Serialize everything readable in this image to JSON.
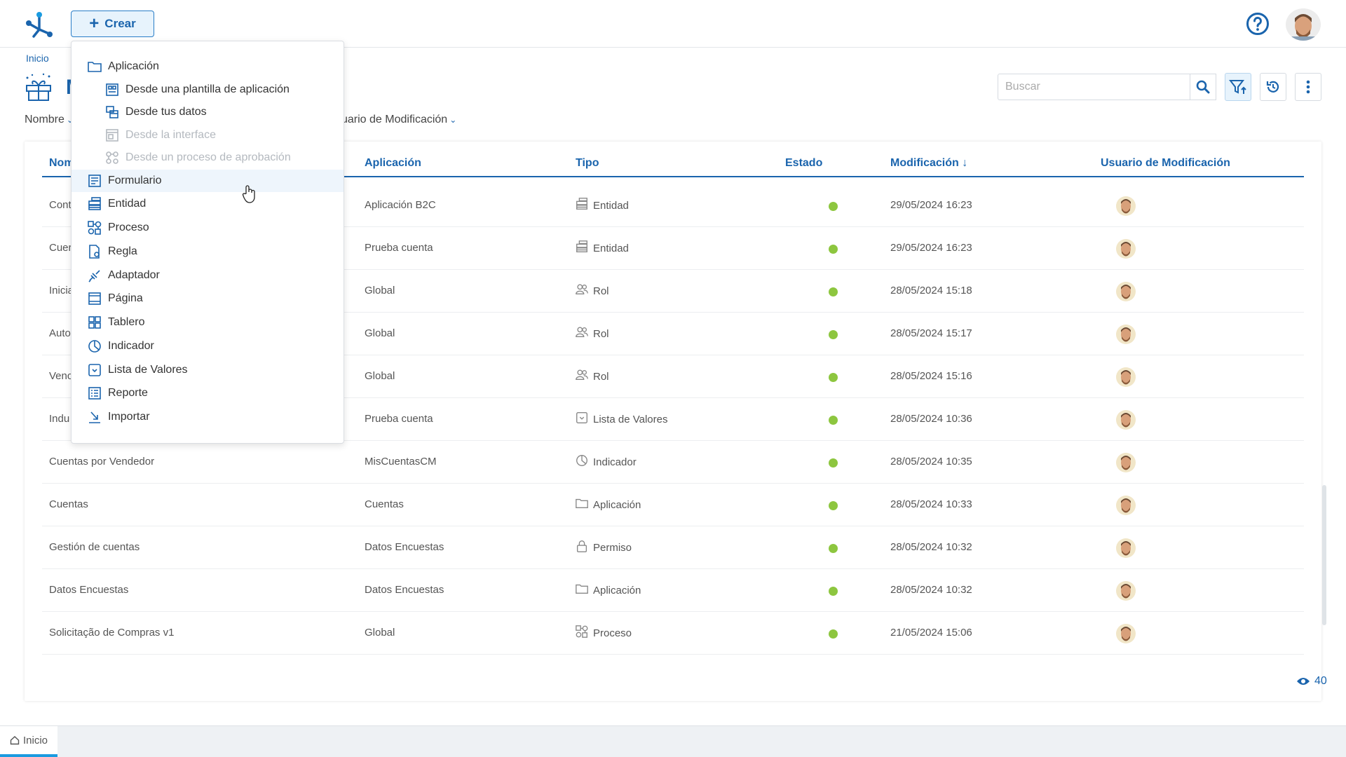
{
  "header": {
    "create_label": "Crear"
  },
  "breadcrumb": "Inicio",
  "page": {
    "title_partial": "M"
  },
  "search": {
    "placeholder": "Buscar"
  },
  "sort": {
    "nombre": "Nombre",
    "usuario": "uario de Modificación"
  },
  "table": {
    "columns": {
      "nombre": "Nom",
      "aplicacion": "Aplicación",
      "tipo": "Tipo",
      "estado": "Estado",
      "modificacion": "Modificación",
      "usuario": "Usuario de Modificación"
    },
    "rows": [
      {
        "name": "Cont",
        "app": "Aplicación B2C",
        "type": "Entidad",
        "icon": "entity-icon",
        "date": "29/05/2024 16:23"
      },
      {
        "name": "Cuer",
        "app": "Prueba cuenta",
        "type": "Entidad",
        "icon": "entity-icon",
        "date": "29/05/2024 16:23"
      },
      {
        "name": "Inicia",
        "app": "Global",
        "type": "Rol",
        "icon": "role-icon",
        "date": "28/05/2024 15:18"
      },
      {
        "name": "Auto",
        "app": "Global",
        "type": "Rol",
        "icon": "role-icon",
        "date": "28/05/2024 15:17"
      },
      {
        "name": "Venc",
        "app": "Global",
        "type": "Rol",
        "icon": "role-icon",
        "date": "28/05/2024 15:16"
      },
      {
        "name": "Indu",
        "app": "Prueba cuenta",
        "type": "Lista de Valores",
        "icon": "value-list-icon",
        "date": "28/05/2024 10:36"
      },
      {
        "name": "Cuentas por Vendedor",
        "app": "MisCuentasCM",
        "type": "Indicador",
        "icon": "indicator-icon",
        "date": "28/05/2024 10:35"
      },
      {
        "name": "Cuentas",
        "app": "Cuentas",
        "type": "Aplicación",
        "icon": "folder-icon",
        "date": "28/05/2024 10:33"
      },
      {
        "name": "Gestión de cuentas",
        "app": "Datos Encuestas",
        "type": "Permiso",
        "icon": "lock-icon",
        "date": "28/05/2024 10:32"
      },
      {
        "name": "Datos Encuestas",
        "app": "Datos Encuestas",
        "type": "Aplicación",
        "icon": "folder-icon",
        "date": "28/05/2024 10:32"
      },
      {
        "name": "Solicitação de Compras v1",
        "app": "Global",
        "type": "Proceso",
        "icon": "process-icon",
        "date": "21/05/2024 15:06"
      }
    ]
  },
  "count": "40",
  "menu": {
    "items": [
      {
        "label": "Aplicación",
        "level": 1,
        "icon": "folder-icon",
        "state": "enabled"
      },
      {
        "label": "Desde una plantilla de aplicación",
        "level": 2,
        "icon": "template-icon",
        "state": "enabled"
      },
      {
        "label": "Desde tus datos",
        "level": 2,
        "icon": "data-icon",
        "state": "enabled"
      },
      {
        "label": "Desde la interface",
        "level": 2,
        "icon": "interface-icon",
        "state": "disabled"
      },
      {
        "label": "Desde un proceso de aprobación",
        "level": 2,
        "icon": "approval-icon",
        "state": "disabled"
      },
      {
        "label": "Formulario",
        "level": 1,
        "icon": "form-icon",
        "state": "hover"
      },
      {
        "label": "Entidad",
        "level": 1,
        "icon": "entity-icon",
        "state": "enabled"
      },
      {
        "label": "Proceso",
        "level": 1,
        "icon": "process-icon",
        "state": "enabled"
      },
      {
        "label": "Regla",
        "level": 1,
        "icon": "rule-icon",
        "state": "enabled"
      },
      {
        "label": "Adaptador",
        "level": 1,
        "icon": "adapter-icon",
        "state": "enabled"
      },
      {
        "label": "Página",
        "level": 1,
        "icon": "page-icon",
        "state": "enabled"
      },
      {
        "label": "Tablero",
        "level": 1,
        "icon": "dashboard-icon",
        "state": "enabled"
      },
      {
        "label": "Indicador",
        "level": 1,
        "icon": "indicator-icon",
        "state": "enabled"
      },
      {
        "label": "Lista de Valores",
        "level": 1,
        "icon": "value-list-icon",
        "state": "enabled"
      },
      {
        "label": "Reporte",
        "level": 1,
        "icon": "report-icon",
        "state": "enabled"
      },
      {
        "label": "Importar",
        "level": 1,
        "icon": "import-icon",
        "state": "enabled"
      }
    ]
  },
  "bottom_tab": "Inicio",
  "colors": {
    "primary": "#1a64ad",
    "status_active": "#8dc63f"
  }
}
